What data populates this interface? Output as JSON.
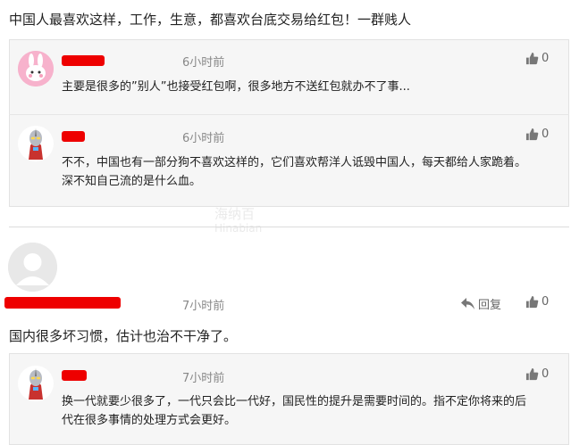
{
  "headline": "中国人最喜欢这样，工作，生意，都喜欢台底交易给红包！一群贱人",
  "thread1": {
    "reply1": {
      "time": "6小时前",
      "likes": "0",
      "text": "主要是很多的”别人”也接受红包啊，很多地方不送红包就办不了事..."
    },
    "reply2": {
      "time": "6小时前",
      "likes": "0",
      "text_line1": "不不，中国也有一部分狗不喜欢这样的，它们喜欢帮洋人诋毁中国人，每天都给人家跪着。",
      "text_line2": "深不知自己流的是什么血。"
    }
  },
  "watermark": {
    "line1": "海纳百",
    "line2": "Hinabian"
  },
  "comment2": {
    "time": "7小时前",
    "reply_label": "回复",
    "likes": "0",
    "text": "国内很多坏习惯，估计也治不干净了。",
    "reply": {
      "time": "7小时前",
      "likes": "0",
      "text_line1": "换一代就要少很多了，一代只会比一代好，国民性的提升是需要时间的。指不定你将来的后",
      "text_line2": "代在很多事情的处理方式会更好。"
    }
  },
  "colors": {
    "redacted": "#e00000",
    "reply_bg": "#f6f6f6",
    "meta": "#888888"
  }
}
